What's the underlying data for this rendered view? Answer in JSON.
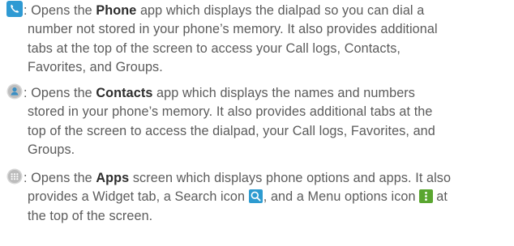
{
  "entries": [
    {
      "app": "Phone",
      "icon": "phone-icon",
      "lines": [
        ": Opens the ",
        " app which displays the dialpad so you can dial a",
        "number not stored in your phone’s memory. It also provides additional",
        "tabs at the top of the screen to access your Call logs, Contacts,",
        "Favorites, and Groups."
      ]
    },
    {
      "app": "Contacts",
      "icon": "contacts-icon",
      "lines": [
        ": Opens the ",
        " app which displays the names and numbers",
        "stored in your phone’s memory. It also provides additional tabs at the",
        "top of the screen to access the dialpad, your Call logs, Favorites, and",
        "Groups."
      ]
    },
    {
      "app": "Apps",
      "icon": "apps-icon",
      "lines": [
        ": Opens the ",
        " screen which displays phone options and apps. It also",
        "provides a Widget tab, a Search icon ",
        ", and a Menu options icon ",
        "at",
        "the top of the screen."
      ]
    }
  ],
  "colors": {
    "text": "#5b5b5b",
    "bold_text": "#2d2d2d",
    "phone_icon": "#2f9ad3",
    "contacts_icon": "#c8c8c8",
    "apps_icon": "#c8c8c8",
    "search_icon": "#2d9bd0",
    "menu_icon": "#5aa630"
  }
}
